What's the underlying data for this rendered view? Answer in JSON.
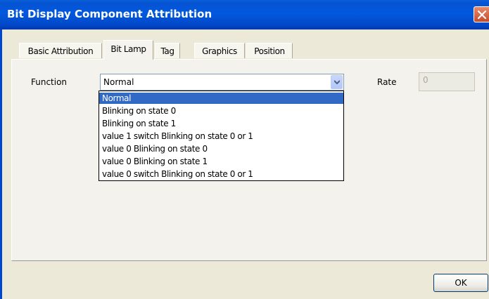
{
  "window": {
    "title": "Bit Display Component Attribution",
    "close_icon": "close-icon"
  },
  "tabs": [
    {
      "label": "Basic Attribution"
    },
    {
      "label": "Bit Lamp",
      "active": true
    },
    {
      "label": "Tag"
    },
    {
      "label": "Graphics"
    },
    {
      "label": "Position"
    }
  ],
  "form": {
    "function_label": "Function",
    "function_value": "Normal",
    "rate_label": "Rate",
    "rate_value": "0"
  },
  "dropdown": {
    "options": [
      "Normal",
      "Blinking on state 0",
      "Blinking on state 1",
      "value 1 switch Blinking on state 0 or 1",
      "value 0 Blinking on state 0",
      "value 0 Blinking on state 1",
      "value 0 switch Blinking on state 0 or 1"
    ],
    "selected_index": 0
  },
  "footer": {
    "ok_label": "OK"
  },
  "colors": {
    "titlebar": "#0258DE",
    "selection": "#316AC5",
    "face": "#ECE9D8"
  }
}
